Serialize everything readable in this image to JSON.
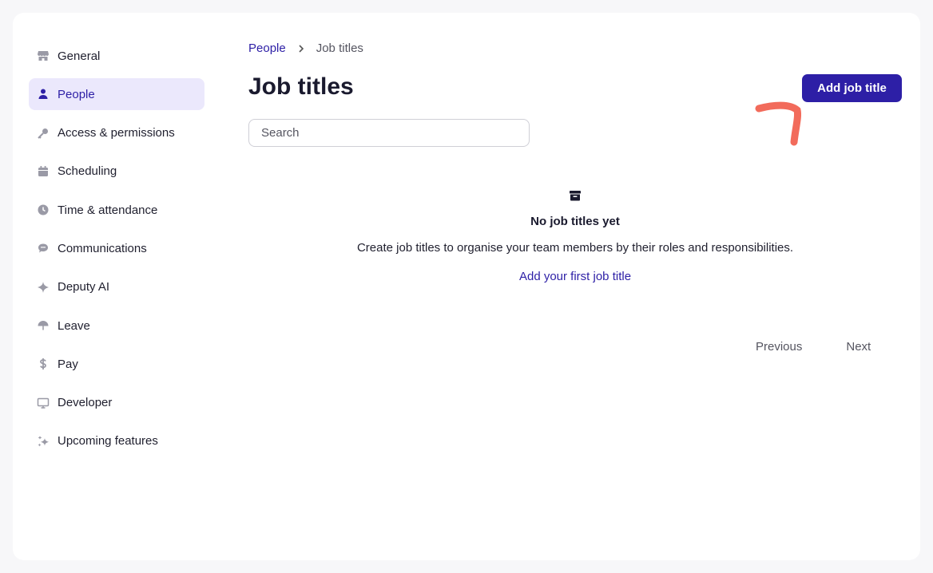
{
  "sidebar": {
    "items": [
      {
        "label": "General",
        "icon": "store-icon",
        "active": false
      },
      {
        "label": "People",
        "icon": "person-icon",
        "active": true
      },
      {
        "label": "Access & permissions",
        "icon": "key-icon",
        "active": false
      },
      {
        "label": "Scheduling",
        "icon": "calendar-icon",
        "active": false
      },
      {
        "label": "Time & attendance",
        "icon": "clock-icon",
        "active": false
      },
      {
        "label": "Communications",
        "icon": "chat-icon",
        "active": false
      },
      {
        "label": "Deputy AI",
        "icon": "sparkle-icon",
        "active": false
      },
      {
        "label": "Leave",
        "icon": "umbrella-icon",
        "active": false
      },
      {
        "label": "Pay",
        "icon": "dollar-icon",
        "active": false
      },
      {
        "label": "Developer",
        "icon": "monitor-icon",
        "active": false
      },
      {
        "label": "Upcoming features",
        "icon": "sparkles-icon",
        "active": false
      }
    ]
  },
  "breadcrumb": {
    "parent": "People",
    "current": "Job titles"
  },
  "header": {
    "title": "Job titles",
    "add_button_label": "Add job title"
  },
  "search": {
    "placeholder": "Search",
    "value": ""
  },
  "empty_state": {
    "icon": "archive-box-icon",
    "title": "No job titles yet",
    "description": "Create job titles to organise your team members by their roles and responsibilities.",
    "link_label": "Add your first job title"
  },
  "pagination": {
    "previous_label": "Previous",
    "next_label": "Next"
  },
  "colors": {
    "accent": "#2d1fa6",
    "active_bg": "#ebe8fc",
    "annotation": "#f26b5b"
  }
}
